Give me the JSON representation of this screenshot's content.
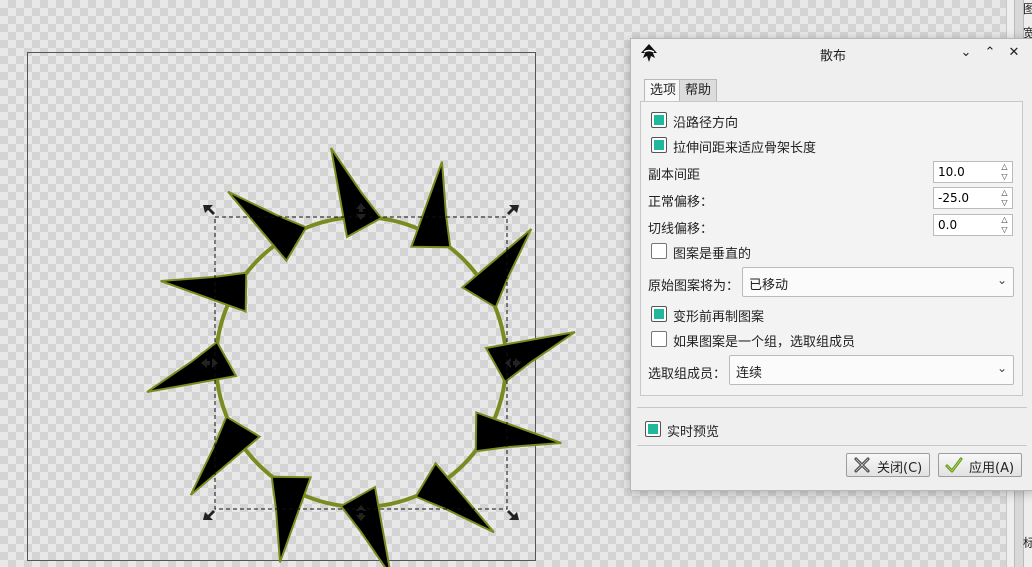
{
  "dialog": {
    "title": "散布",
    "tabs": [
      {
        "label": "选项"
      },
      {
        "label": "帮助"
      }
    ],
    "options": {
      "follow_path": {
        "label": "沿路径方向",
        "checked": true
      },
      "stretch_spacing": {
        "label": "拉伸间距来适应骨架长度",
        "checked": true
      },
      "spacing": {
        "label": "副本间距",
        "value": "10.0"
      },
      "normal_offset": {
        "label": "正常偏移：",
        "value": "-25.0"
      },
      "tangential_offset": {
        "label": "切线偏移：",
        "value": "0.0"
      },
      "pattern_vertical": {
        "label": "图案是垂直的",
        "checked": false
      },
      "original_pattern": {
        "label": "原始图案将为：",
        "value": "已移动"
      },
      "duplicate_before": {
        "label": "变形前再制图案",
        "checked": true
      },
      "pick_group_members": {
        "label": "如果图案是一个组，选取组成员",
        "checked": false
      },
      "pick_method": {
        "label": "选取组成员：",
        "value": "连续"
      }
    },
    "live_preview": {
      "label": "实时预览",
      "checked": true
    },
    "buttons": {
      "close": "关闭(C)",
      "apply": "应用(A)"
    }
  },
  "right_dock": {
    "text_top": "图",
    "text_second": "宽",
    "text_bottom": "标"
  },
  "colors": {
    "accent": "#1fb89c",
    "path_stroke": "#7a8c1f",
    "star_fill": "#000000",
    "canvas": "#e8e8e8"
  },
  "icons": [
    "inkscape-logo-icon",
    "minimize-chevron-icon",
    "maximize-chevron-icon",
    "close-x-icon",
    "close-icon",
    "apply-checkmark-icon",
    "combo-chevron-icon",
    "spin-arrows-icon"
  ]
}
